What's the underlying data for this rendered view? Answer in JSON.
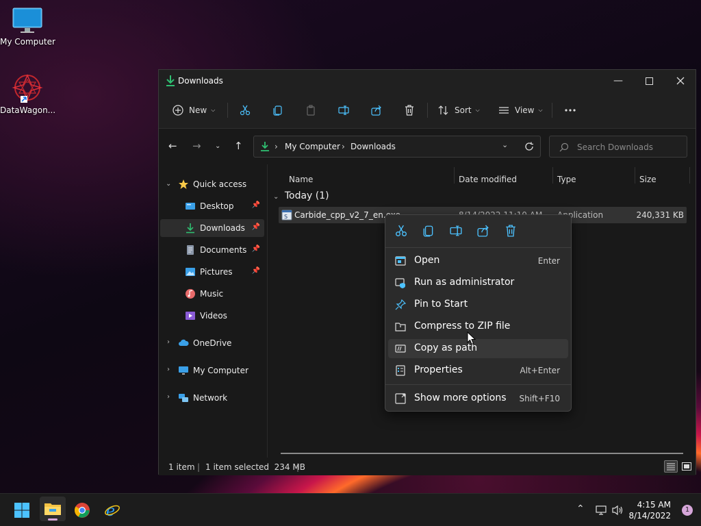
{
  "desktop": {
    "icons": [
      {
        "label": "My Computer",
        "icon": "monitor-icon"
      },
      {
        "label": "DataWagon...",
        "icon": "datawagon-app-icon"
      }
    ]
  },
  "window": {
    "title": "Downloads",
    "toolbar": {
      "new_label": "New",
      "sort_label": "Sort",
      "view_label": "View"
    },
    "address": {
      "segments": [
        "My Computer",
        "Downloads"
      ]
    },
    "search": {
      "placeholder": "Search Downloads"
    },
    "sidebar": {
      "quick_access": "Quick access",
      "items": [
        {
          "label": "Desktop",
          "pinned": true
        },
        {
          "label": "Downloads",
          "pinned": true,
          "selected": true
        },
        {
          "label": "Documents",
          "pinned": true
        },
        {
          "label": "Pictures",
          "pinned": true
        },
        {
          "label": "Music"
        },
        {
          "label": "Videos"
        }
      ],
      "onedrive": "OneDrive",
      "my_computer": "My Computer",
      "network": "Network"
    },
    "columns": [
      "Name",
      "Date modified",
      "Type",
      "Size"
    ],
    "group": "Today (1)",
    "files": [
      {
        "name": "Carbide_cpp_v2_7_en.exe",
        "date": "8/14/2022 11:10 AM",
        "type": "Application",
        "size": "240,331 KB"
      }
    ],
    "status": {
      "count": "1 item",
      "selected": "1 item selected  234 MB"
    }
  },
  "context_menu": {
    "items": [
      {
        "label": "Open",
        "shortcut": "Enter"
      },
      {
        "label": "Run as administrator",
        "shortcut": ""
      },
      {
        "label": "Pin to Start",
        "shortcut": ""
      },
      {
        "label": "Compress to ZIP file",
        "shortcut": ""
      },
      {
        "label": "Copy as path",
        "shortcut": ""
      },
      {
        "label": "Properties",
        "shortcut": "Alt+Enter"
      },
      {
        "label": "Show more options",
        "shortcut": "Shift+F10"
      }
    ]
  },
  "taskbar": {
    "time": "4:15 AM",
    "date": "8/14/2022",
    "notifications": "1"
  },
  "colors": {
    "accent": "#4cc2ff",
    "download_green": "#2fbf71"
  }
}
